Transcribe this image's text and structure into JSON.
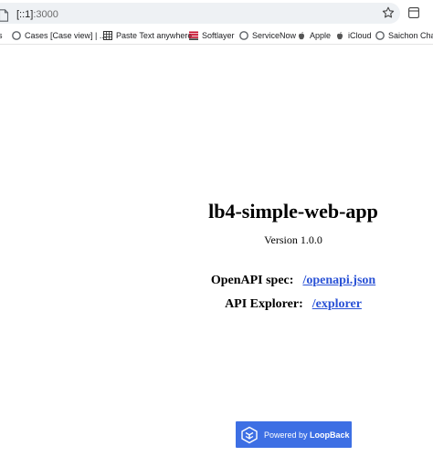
{
  "browser": {
    "url_host": "[::1]",
    "url_port": ":3000"
  },
  "bookmarks": [
    {
      "label": "s",
      "icon": "folder-icon"
    },
    {
      "label": "Cases [Case view] | ...",
      "icon": "circle-icon"
    },
    {
      "label": "Paste Text anywhere",
      "icon": "grid-icon"
    },
    {
      "label": "Softlayer",
      "icon": "striped-logo-icon"
    },
    {
      "label": "ServiceNow",
      "icon": "circle-icon"
    },
    {
      "label": "Apple",
      "icon": "apple-icon"
    },
    {
      "label": "iCloud",
      "icon": "apple-icon"
    },
    {
      "label": "Saichon Chaiy",
      "icon": "circle-icon"
    }
  ],
  "page": {
    "title": "lb4-simple-web-app",
    "version": "Version 1.0.0",
    "openapi_label": "OpenAPI spec:",
    "openapi_link": "/openapi.json",
    "explorer_label": "API Explorer:",
    "explorer_link": "/explorer"
  },
  "footer_button": {
    "prefix": "Powered by ",
    "brand": "LoopBack"
  },
  "colors": {
    "link": "#2a52d6",
    "button_bg": "#3d6fe4"
  }
}
